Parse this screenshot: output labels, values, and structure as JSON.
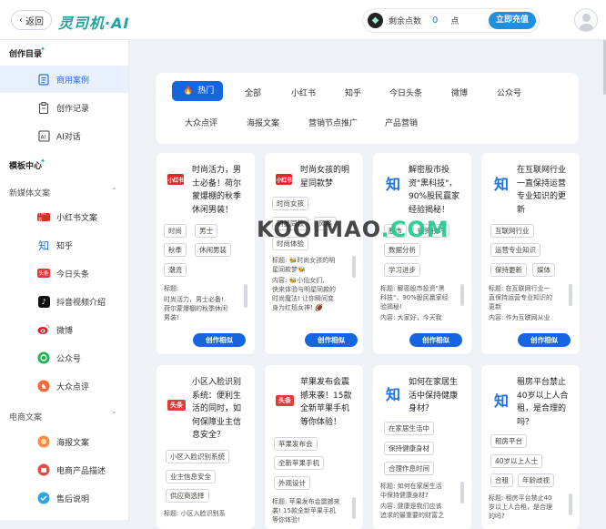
{
  "header": {
    "back_label": "返回",
    "logo_text": "灵司机·AI",
    "points_label": "剩余点数",
    "points_value": "0",
    "points_unit": "点",
    "recharge_label": "立即充值"
  },
  "sidebar": {
    "section_create": "创作目录",
    "create_items": [
      {
        "label": "商用案例",
        "icon": "document-icon",
        "active": true
      },
      {
        "label": "创作记录",
        "icon": "record-icon",
        "active": false
      },
      {
        "label": "AI对话",
        "icon": "ai-chat-icon",
        "active": false
      }
    ],
    "section_template": "模板中心",
    "group_newmedia": "新媒体文案",
    "newmedia_items": [
      {
        "label": "小红书文案",
        "icon": "xiaohongshu-icon"
      },
      {
        "label": "知乎",
        "icon": "zhihu-icon"
      },
      {
        "label": "今日头条",
        "icon": "toutiao-icon"
      },
      {
        "label": "抖音视频介绍",
        "icon": "douyin-icon"
      },
      {
        "label": "微博",
        "icon": "weibo-icon"
      },
      {
        "label": "公众号",
        "icon": "wechat-icon"
      },
      {
        "label": "大众点评",
        "icon": "dianping-icon"
      }
    ],
    "group_ecommerce": "电商文案",
    "ecommerce_items": [
      {
        "label": "海报文案",
        "icon": "poster-icon"
      },
      {
        "label": "电商产品描述",
        "icon": "product-icon"
      },
      {
        "label": "售后说明",
        "icon": "aftersale-icon"
      }
    ]
  },
  "filter": {
    "tabs_row1": [
      "热门",
      "全部",
      "小红书",
      "知乎",
      "今日头条",
      "微博",
      "公众号"
    ],
    "tabs_row2": [
      "大众点评",
      "海报文案",
      "营销节点推广",
      "产品营销"
    ]
  },
  "watermark": {
    "part1": "KOOIMAO",
    "part2": ".COM"
  },
  "cards": [
    {
      "icon": "xiaohongshu",
      "title": "时尚活力，男士必备！荷尔蒙爆棚的秋季休闲男装！",
      "tags": [
        "时尚",
        "男士",
        "秋季",
        "休闲男装",
        "潮流"
      ],
      "text": [
        "标题:",
        "",
        "时尚活力，男士必备!",
        "荷尔蒙爆棚的秋季休闲",
        "男装!"
      ],
      "button": "创作相似"
    },
    {
      "icon": "xiaohongshu",
      "title": "时尚女孩的明星同款梦",
      "tags": [
        "时尚女孩",
        "明星同款",
        "风格",
        "时尚体验"
      ],
      "text": [
        "标题: 🐝时尚女孩的明",
        "星同款梦🐝",
        "内容: 🐝小仙女们,",
        "快来体验与明星同款的",
        "时尚魔法! 让你瞬间变",
        "身为红毯女神! 🏈"
      ],
      "button": "创作相似"
    },
    {
      "icon": "zhihu",
      "title": "解密股市投资\"黑科技\"，90%股民赢家经验揭秘！",
      "tags": [
        "股市",
        "投资技巧",
        "数据分析",
        "学习进步"
      ],
      "text": [
        "标题: 解密股市投资\"黑",
        "科技\"，90%股民赢家经",
        "验揭秘!",
        "内容: 大家好，今天我"
      ],
      "button": "创作相似"
    },
    {
      "icon": "zhihu",
      "title": "在互联网行业一直保持运营专业知识的更新",
      "tags": [
        "互联网行业",
        "运营专业知识",
        "保持更新",
        "媒体"
      ],
      "text": [
        "标题: 在互联网行业一",
        "直保持运营专业知识的",
        "更新",
        "内容: 作为互联网从业"
      ],
      "button": "创作相似"
    },
    {
      "icon": "toutiao",
      "title": "小区入脸识别系统：便利生活的同时，如何保障业主信息安全？",
      "tags": [
        "小区入脸识别系统",
        "业主信息安全",
        "供应商选择"
      ],
      "text": [
        "标题: 小区入脸识别系"
      ],
      "button": "创作相似"
    },
    {
      "icon": "toutiao",
      "title": "苹果发布会震撼来袭！15款全新苹果手机等你体验！",
      "tags": [
        "苹果发布会",
        "全新苹果手机",
        "外观设计"
      ],
      "text": [
        "标题: 苹果发布会震撼来",
        "袭! 15款全新苹果手机",
        "等你体验!"
      ],
      "button": "创作相似"
    },
    {
      "icon": "zhihu",
      "title": "如何在家居生活中保持健康身材？",
      "tags": [
        "在家居生活中",
        "保持健康身材",
        "合理作息时间"
      ],
      "text": [
        "标题: 如何在家居生活",
        "中保持健康身材?",
        "内容: 健康是我们应该",
        "追求的最重要的财富之"
      ],
      "button": "创作相似"
    },
    {
      "icon": "zhihu",
      "title": "租房平台禁止40岁以上人合租，是合理的吗？",
      "tags": [
        "租房平台",
        "40岁以上人士",
        "合租",
        "年龄歧视"
      ],
      "text": [
        "标题: 租房平台禁止40",
        "岁以上人合租，是合理",
        "的吗?"
      ],
      "button": "创作相似"
    }
  ]
}
